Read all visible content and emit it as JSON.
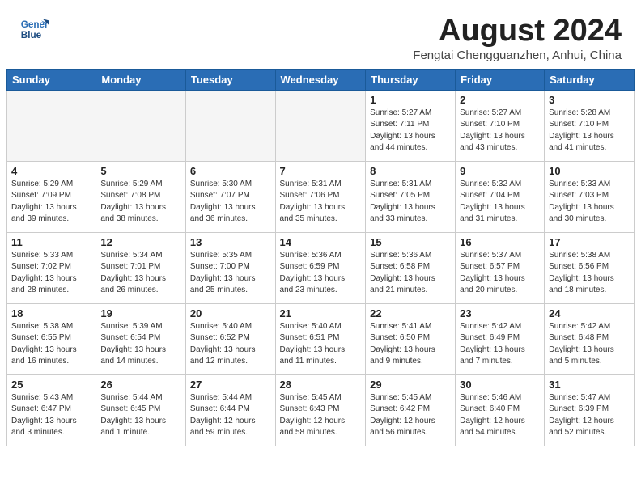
{
  "header": {
    "logo_line1": "General",
    "logo_line2": "Blue",
    "month_year": "August 2024",
    "location": "Fengtai Chengguanzhen, Anhui, China"
  },
  "days_of_week": [
    "Sunday",
    "Monday",
    "Tuesday",
    "Wednesday",
    "Thursday",
    "Friday",
    "Saturday"
  ],
  "weeks": [
    [
      {
        "day": "",
        "info": ""
      },
      {
        "day": "",
        "info": ""
      },
      {
        "day": "",
        "info": ""
      },
      {
        "day": "",
        "info": ""
      },
      {
        "day": "1",
        "info": "Sunrise: 5:27 AM\nSunset: 7:11 PM\nDaylight: 13 hours\nand 44 minutes."
      },
      {
        "day": "2",
        "info": "Sunrise: 5:27 AM\nSunset: 7:10 PM\nDaylight: 13 hours\nand 43 minutes."
      },
      {
        "day": "3",
        "info": "Sunrise: 5:28 AM\nSunset: 7:10 PM\nDaylight: 13 hours\nand 41 minutes."
      }
    ],
    [
      {
        "day": "4",
        "info": "Sunrise: 5:29 AM\nSunset: 7:09 PM\nDaylight: 13 hours\nand 39 minutes."
      },
      {
        "day": "5",
        "info": "Sunrise: 5:29 AM\nSunset: 7:08 PM\nDaylight: 13 hours\nand 38 minutes."
      },
      {
        "day": "6",
        "info": "Sunrise: 5:30 AM\nSunset: 7:07 PM\nDaylight: 13 hours\nand 36 minutes."
      },
      {
        "day": "7",
        "info": "Sunrise: 5:31 AM\nSunset: 7:06 PM\nDaylight: 13 hours\nand 35 minutes."
      },
      {
        "day": "8",
        "info": "Sunrise: 5:31 AM\nSunset: 7:05 PM\nDaylight: 13 hours\nand 33 minutes."
      },
      {
        "day": "9",
        "info": "Sunrise: 5:32 AM\nSunset: 7:04 PM\nDaylight: 13 hours\nand 31 minutes."
      },
      {
        "day": "10",
        "info": "Sunrise: 5:33 AM\nSunset: 7:03 PM\nDaylight: 13 hours\nand 30 minutes."
      }
    ],
    [
      {
        "day": "11",
        "info": "Sunrise: 5:33 AM\nSunset: 7:02 PM\nDaylight: 13 hours\nand 28 minutes."
      },
      {
        "day": "12",
        "info": "Sunrise: 5:34 AM\nSunset: 7:01 PM\nDaylight: 13 hours\nand 26 minutes."
      },
      {
        "day": "13",
        "info": "Sunrise: 5:35 AM\nSunset: 7:00 PM\nDaylight: 13 hours\nand 25 minutes."
      },
      {
        "day": "14",
        "info": "Sunrise: 5:36 AM\nSunset: 6:59 PM\nDaylight: 13 hours\nand 23 minutes."
      },
      {
        "day": "15",
        "info": "Sunrise: 5:36 AM\nSunset: 6:58 PM\nDaylight: 13 hours\nand 21 minutes."
      },
      {
        "day": "16",
        "info": "Sunrise: 5:37 AM\nSunset: 6:57 PM\nDaylight: 13 hours\nand 20 minutes."
      },
      {
        "day": "17",
        "info": "Sunrise: 5:38 AM\nSunset: 6:56 PM\nDaylight: 13 hours\nand 18 minutes."
      }
    ],
    [
      {
        "day": "18",
        "info": "Sunrise: 5:38 AM\nSunset: 6:55 PM\nDaylight: 13 hours\nand 16 minutes."
      },
      {
        "day": "19",
        "info": "Sunrise: 5:39 AM\nSunset: 6:54 PM\nDaylight: 13 hours\nand 14 minutes."
      },
      {
        "day": "20",
        "info": "Sunrise: 5:40 AM\nSunset: 6:52 PM\nDaylight: 13 hours\nand 12 minutes."
      },
      {
        "day": "21",
        "info": "Sunrise: 5:40 AM\nSunset: 6:51 PM\nDaylight: 13 hours\nand 11 minutes."
      },
      {
        "day": "22",
        "info": "Sunrise: 5:41 AM\nSunset: 6:50 PM\nDaylight: 13 hours\nand 9 minutes."
      },
      {
        "day": "23",
        "info": "Sunrise: 5:42 AM\nSunset: 6:49 PM\nDaylight: 13 hours\nand 7 minutes."
      },
      {
        "day": "24",
        "info": "Sunrise: 5:42 AM\nSunset: 6:48 PM\nDaylight: 13 hours\nand 5 minutes."
      }
    ],
    [
      {
        "day": "25",
        "info": "Sunrise: 5:43 AM\nSunset: 6:47 PM\nDaylight: 13 hours\nand 3 minutes."
      },
      {
        "day": "26",
        "info": "Sunrise: 5:44 AM\nSunset: 6:45 PM\nDaylight: 13 hours\nand 1 minute."
      },
      {
        "day": "27",
        "info": "Sunrise: 5:44 AM\nSunset: 6:44 PM\nDaylight: 12 hours\nand 59 minutes."
      },
      {
        "day": "28",
        "info": "Sunrise: 5:45 AM\nSunset: 6:43 PM\nDaylight: 12 hours\nand 58 minutes."
      },
      {
        "day": "29",
        "info": "Sunrise: 5:45 AM\nSunset: 6:42 PM\nDaylight: 12 hours\nand 56 minutes."
      },
      {
        "day": "30",
        "info": "Sunrise: 5:46 AM\nSunset: 6:40 PM\nDaylight: 12 hours\nand 54 minutes."
      },
      {
        "day": "31",
        "info": "Sunrise: 5:47 AM\nSunset: 6:39 PM\nDaylight: 12 hours\nand 52 minutes."
      }
    ]
  ]
}
